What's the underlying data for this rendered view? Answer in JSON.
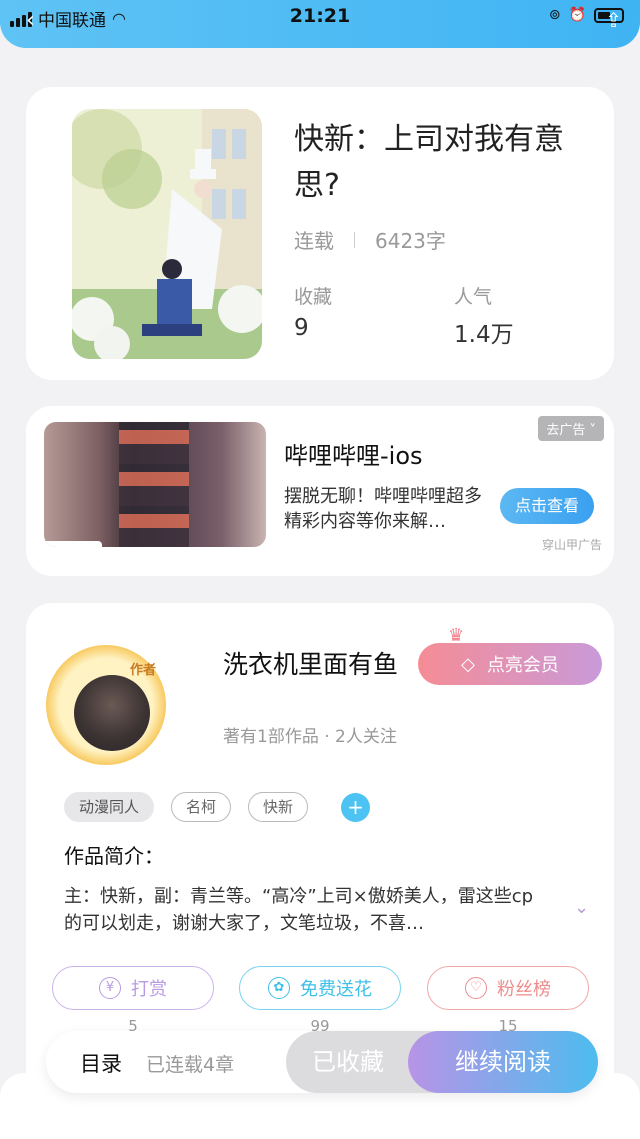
{
  "status_bar": {
    "carrier": "中国联通",
    "time": "21:21"
  },
  "book": {
    "title": "快新：上司对我有意思?",
    "status": "连载",
    "word_count": "6423字",
    "favorites_label": "收藏",
    "favorites_value": "9",
    "popularity_label": "人气",
    "popularity_value": "1.4万"
  },
  "ad": {
    "title": "哔哩哔哩-ios",
    "description": "摆脱无聊！哔哩哔哩超多精彩内容等你来解…",
    "close_label": "去广告 ˅",
    "button_label": "点击查看",
    "source": "穿山甲广告"
  },
  "author": {
    "badge": "作者",
    "name": "洗衣机里面有鱼",
    "vip_label": "点亮会员",
    "meta": "著有1部作品 · 2人关注",
    "tags": [
      "动漫同人",
      "名柯",
      "快新"
    ],
    "add_tag": "+",
    "intro_title": "作品简介：",
    "intro_text": "主：快新，副：青兰等。“高冷”上司×傲娇美人，雷这些cp的可以划走，谢谢大家了，文笔垃圾，不喜…"
  },
  "actions": [
    {
      "label": "打赏",
      "count": "5",
      "color": "#b89be3",
      "icon": "¥"
    },
    {
      "label": "免费送花",
      "count": "99",
      "color": "#3fc0e8",
      "icon": "✿"
    },
    {
      "label": "粉丝榜",
      "count": "15",
      "color": "#ee8c8c",
      "icon": "♡"
    }
  ],
  "bottom_bar": {
    "toc_label": "目录",
    "serial_label": "已连载4章",
    "collected_label": "已收藏",
    "read_label": "继续阅读"
  }
}
